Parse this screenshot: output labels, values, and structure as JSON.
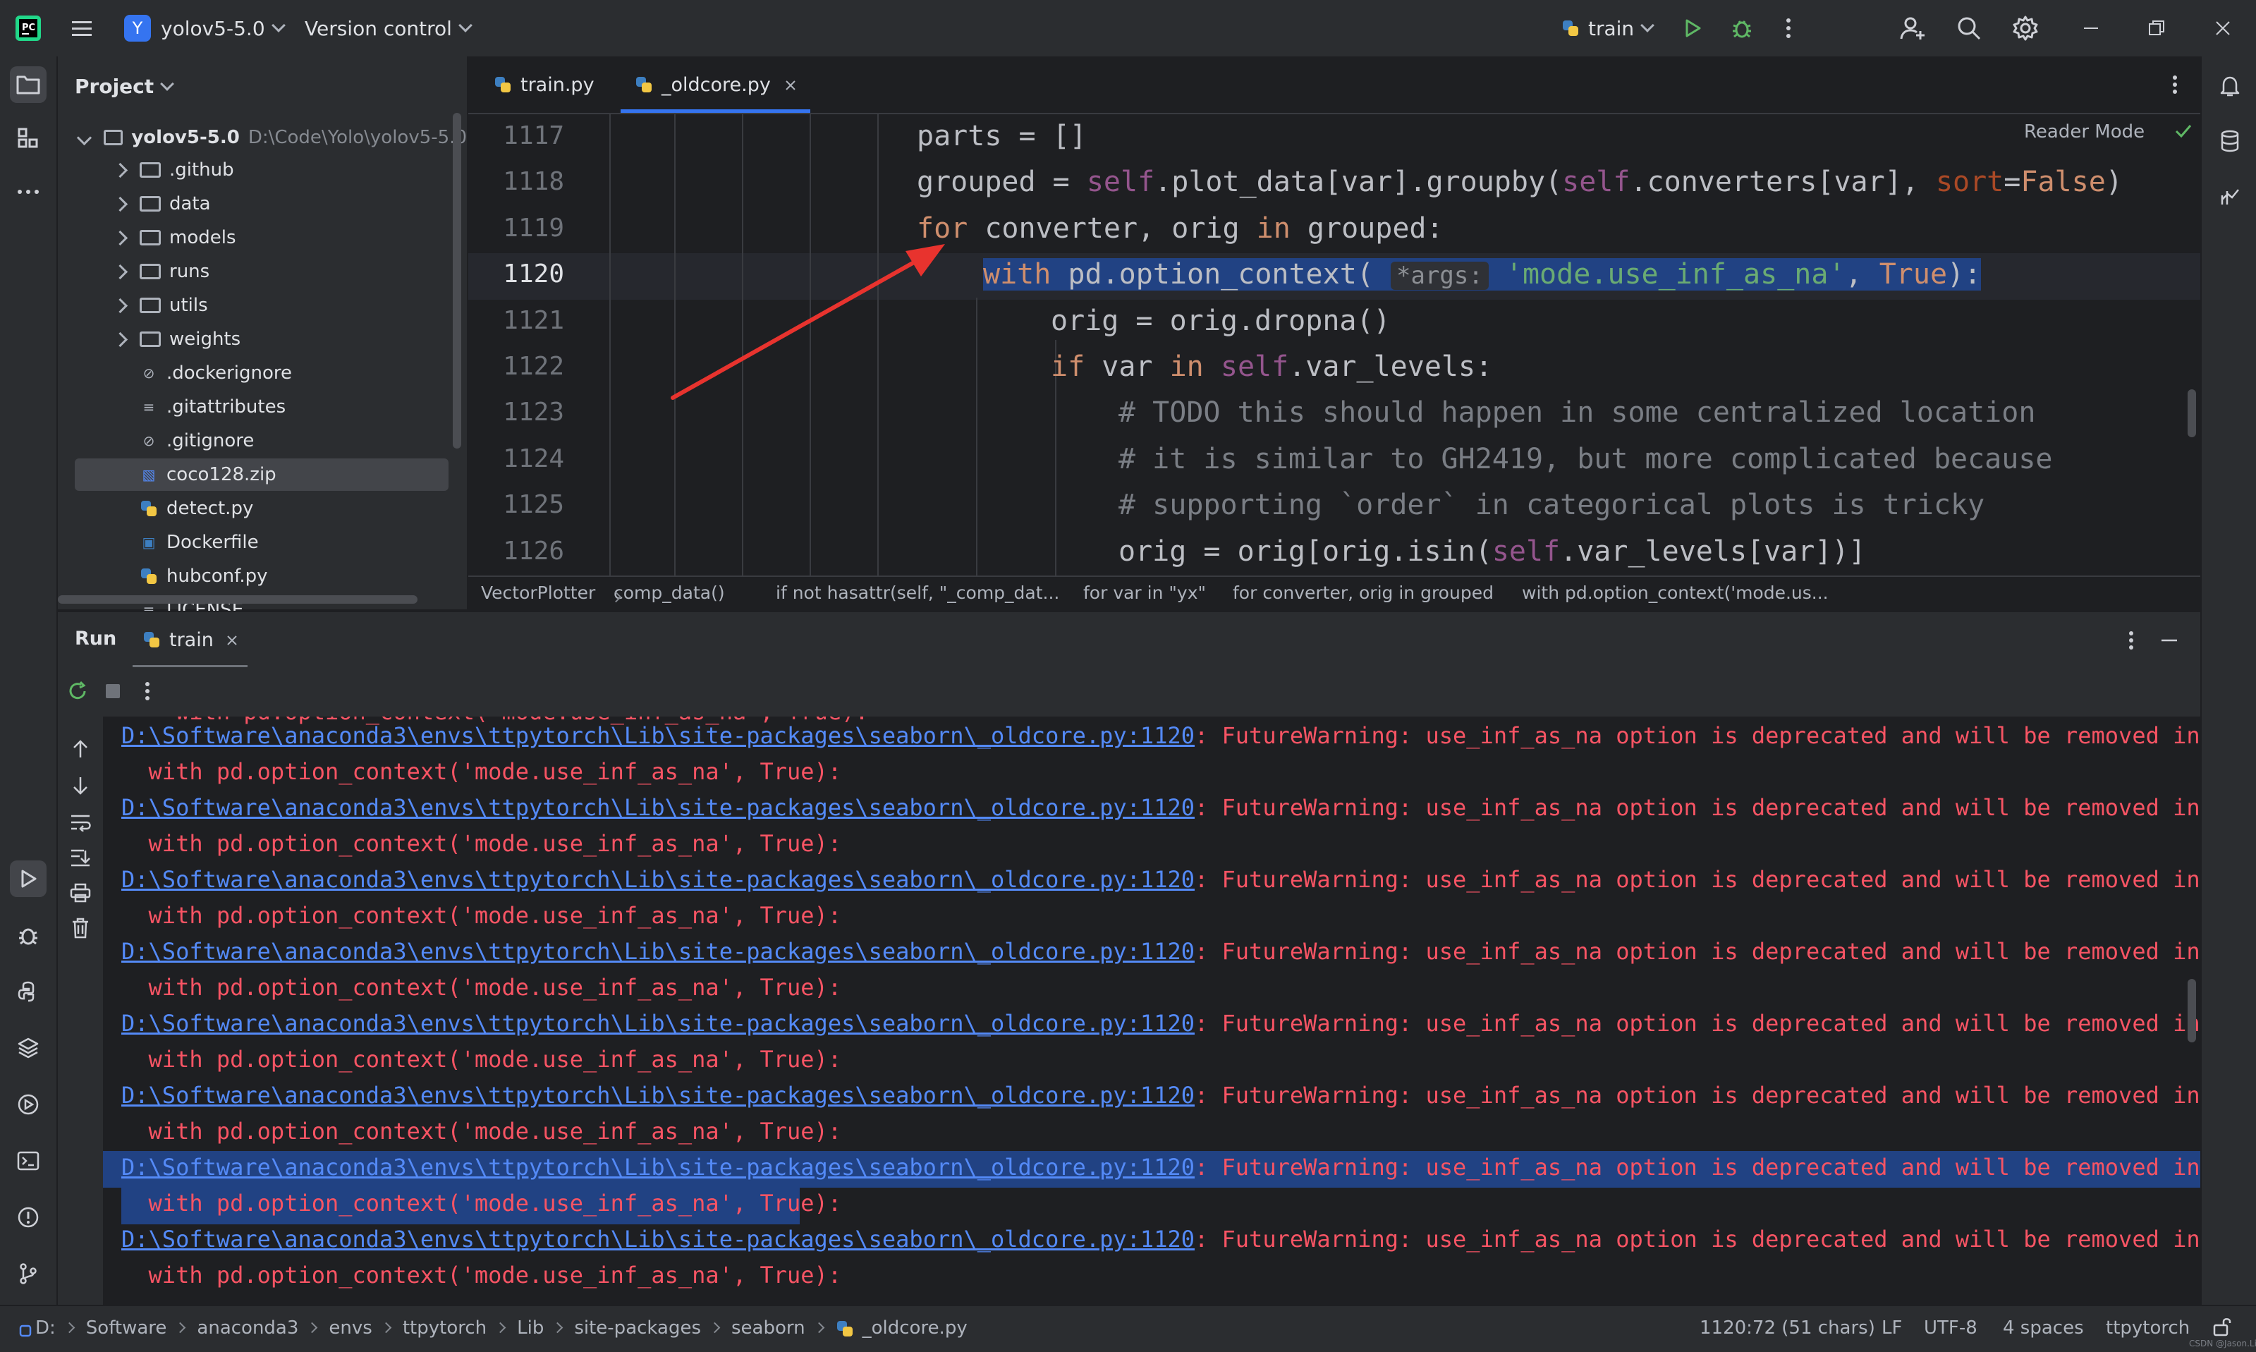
{
  "titlebar": {
    "project_badge": "Y",
    "project_name": "yolov5-5.0",
    "vcs": "Version control",
    "run_config": "train",
    "icons": [
      "hamburger-icon",
      "run-icon",
      "debug-icon",
      "more-icon",
      "add-user-icon",
      "search-icon",
      "gear-icon",
      "minimize-icon",
      "maximize-icon",
      "close-icon"
    ]
  },
  "project_panel": {
    "title": "Project",
    "root": {
      "name": "yolov5-5.0",
      "path": "D:\\Code\\Yolo\\yolov5-5.0"
    },
    "items": [
      {
        "name": ".github",
        "type": "folder"
      },
      {
        "name": "data",
        "type": "folder"
      },
      {
        "name": "models",
        "type": "folder"
      },
      {
        "name": "runs",
        "type": "folder"
      },
      {
        "name": "utils",
        "type": "folder"
      },
      {
        "name": "weights",
        "type": "folder"
      },
      {
        "name": ".dockerignore",
        "type": "ignore"
      },
      {
        "name": ".gitattributes",
        "type": "text"
      },
      {
        "name": ".gitignore",
        "type": "ignore"
      },
      {
        "name": "coco128.zip",
        "type": "zip"
      },
      {
        "name": "detect.py",
        "type": "python"
      },
      {
        "name": "Dockerfile",
        "type": "docker"
      },
      {
        "name": "hubconf.py",
        "type": "python"
      },
      {
        "name": "LICENSE",
        "type": "text"
      }
    ]
  },
  "editor": {
    "tabs": [
      {
        "label": "train.py",
        "active": false
      },
      {
        "label": "_oldcore.py",
        "active": true
      }
    ],
    "reader_mode": "Reader Mode",
    "lines": [
      {
        "num": "1117",
        "text": "parts = []"
      },
      {
        "num": "1118",
        "text": "grouped = self.plot_data[var].groupby(self.converters[var], sort=False)"
      },
      {
        "num": "1119",
        "text": "for converter, orig in grouped:"
      },
      {
        "num": "1120",
        "text": "with pd.option_context( *args: 'mode.use_inf_as_na', True):"
      },
      {
        "num": "1121",
        "text": "orig = orig.dropna()"
      },
      {
        "num": "1122",
        "text": "if var in self.var_levels:"
      },
      {
        "num": "1123",
        "text": "# TODO this should happen in some centralized location"
      },
      {
        "num": "1124",
        "text": "# it is similar to GH2419, but more complicated because"
      },
      {
        "num": "1125",
        "text": "# supporting `order` in categorical plots is tricky"
      },
      {
        "num": "1126",
        "text": "orig = orig[orig.isin(self.var_levels[var])]"
      }
    ],
    "hint": "*args:",
    "breadcrumbs": [
      "VectorPlotter",
      "comp_data()",
      "if not hasattr(self, \"_comp_dat...",
      "for var in \"yx\"",
      "for converter, orig in grouped",
      "with pd.option_context('mode.us..."
    ]
  },
  "run_panel": {
    "title": "Run",
    "tab": "train",
    "partial_top": "    with pd.option_context('mode.use_inf_as_na', True):",
    "link": "D:\\Software\\anaconda3\\envs\\ttpytorch\\Lib\\site-packages\\seaborn\\_oldcore.py:1120",
    "warning": ": FutureWarning: use_inf_as_na option is deprecated and will be removed in a future v",
    "context_line": "  with pd.option_context('mode.use_inf_as_na', True):",
    "repeat_count": 8
  },
  "statusbar": {
    "path": [
      "D:",
      "Software",
      "anaconda3",
      "envs",
      "ttpytorch",
      "Lib",
      "site-packages",
      "seaborn",
      "_oldcore.py"
    ],
    "position": "1120:72 (51 chars)",
    "line_sep": "LF",
    "encoding": "UTF-8",
    "indent": "4 spaces",
    "interpreter": "ttpytorch",
    "watermark": "CSDN @Jason.Lin"
  }
}
